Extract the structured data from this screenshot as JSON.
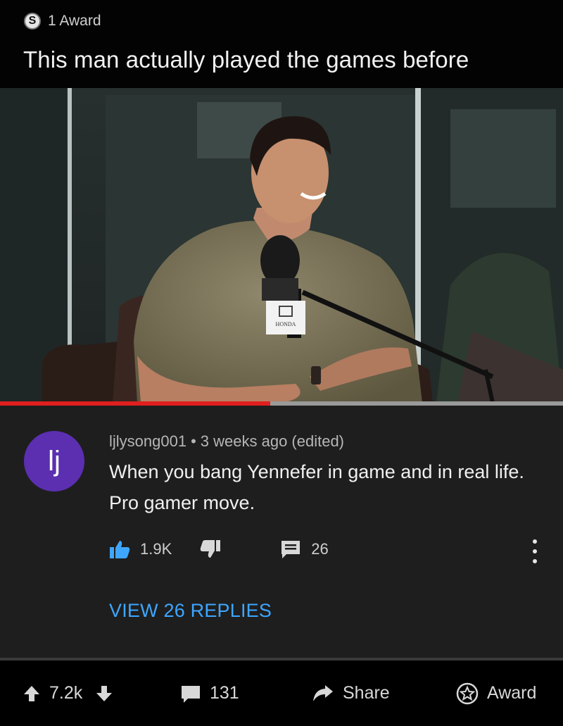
{
  "post": {
    "award_icon_letter": "S",
    "award_text": "1 Award",
    "title": "This man actually played the games before"
  },
  "video": {
    "mic_brand": "HONDA",
    "progress_fraction": 0.48
  },
  "comment": {
    "avatar_letters": "lj",
    "username": "ljlysong001",
    "separator": "•",
    "time": "3 weeks ago (edited)",
    "text": "When you bang Yennefer in game and in real life. Pro gamer  move.",
    "likes": "1.9K",
    "reply_count": "26",
    "view_replies": "VIEW 26 REPLIES"
  },
  "footer": {
    "upvotes": "7.2k",
    "comments": "131",
    "share": "Share",
    "award": "Award"
  },
  "colors": {
    "accent_blue": "#3ea6ff",
    "avatar_purple": "#5b2fb0",
    "progress_red": "#e01f1f"
  }
}
